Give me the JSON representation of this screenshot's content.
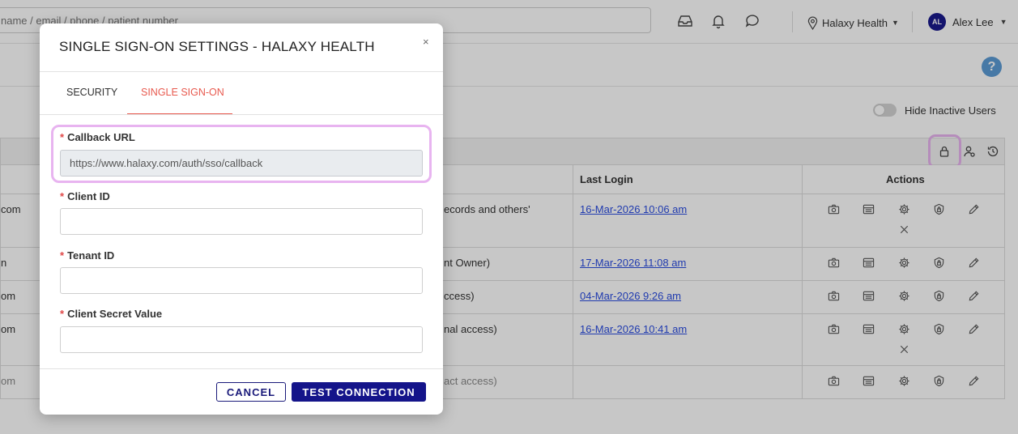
{
  "topbar": {
    "search_placeholder": "name / email / phone / patient number",
    "location_name": "Halaxy Health",
    "user_initials": "AL",
    "user_name": "Alex Lee"
  },
  "toolbar": {
    "hide_inactive_label": "Hide Inactive Users",
    "hide_inactive_on": false
  },
  "table": {
    "headers": {
      "last_login": "Last Login",
      "actions": "Actions"
    },
    "rows": [
      {
        "email_fragment": "com",
        "role_fragment": "ecords and others'",
        "role_sub": "",
        "last_login": "16-Mar-2026 10:06 am",
        "has_delete": true,
        "faded": false
      },
      {
        "email_fragment": "n",
        "role_fragment": "nt Owner)",
        "role_sub": "",
        "last_login": "17-Mar-2026 11:08 am",
        "has_delete": false,
        "faded": false
      },
      {
        "email_fragment": "om",
        "role_fragment": "ccess)",
        "role_sub": "",
        "last_login": "04-Mar-2026 9:26 am",
        "has_delete": false,
        "faded": false
      },
      {
        "email_fragment": "om",
        "role_fragment": "nal access)",
        "role_sub": "",
        "last_login": "16-Mar-2026 10:41 am",
        "has_delete": true,
        "faded": false
      },
      {
        "email_fragment": "om",
        "role_fragment": "act access)",
        "role_sub": "",
        "last_login": "",
        "has_delete": false,
        "faded": true
      }
    ]
  },
  "modal": {
    "title": "SINGLE SIGN-ON SETTINGS - HALAXY HEALTH",
    "close_glyph": "×",
    "tabs": [
      {
        "label": "SECURITY",
        "active": false
      },
      {
        "label": "SINGLE SIGN-ON",
        "active": true
      }
    ],
    "required_mark": "*",
    "fields": {
      "callback_url": {
        "label": "Callback URL",
        "value": "https://www.halaxy.com/auth/sso/callback",
        "readonly": true
      },
      "client_id": {
        "label": "Client ID",
        "value": ""
      },
      "tenant_id": {
        "label": "Tenant ID",
        "value": ""
      },
      "client_secret": {
        "label": "Client Secret Value",
        "value": ""
      }
    },
    "buttons": {
      "cancel": "CANCEL",
      "test_connection": "TEST CONNECTION"
    }
  },
  "colors": {
    "accent_tab": "#e85a4f",
    "primary_button": "#14148a",
    "highlight": "#e8b4f0",
    "link": "#2a4ce0"
  },
  "icons": [
    "inbox-icon",
    "bell-icon",
    "chat-icon",
    "location-pin-icon",
    "help-icon",
    "lock-icon",
    "user-settings-icon",
    "history-icon",
    "camera-icon",
    "calendar-icon",
    "gear-icon",
    "shield-icon",
    "pencil-icon",
    "close-icon"
  ]
}
